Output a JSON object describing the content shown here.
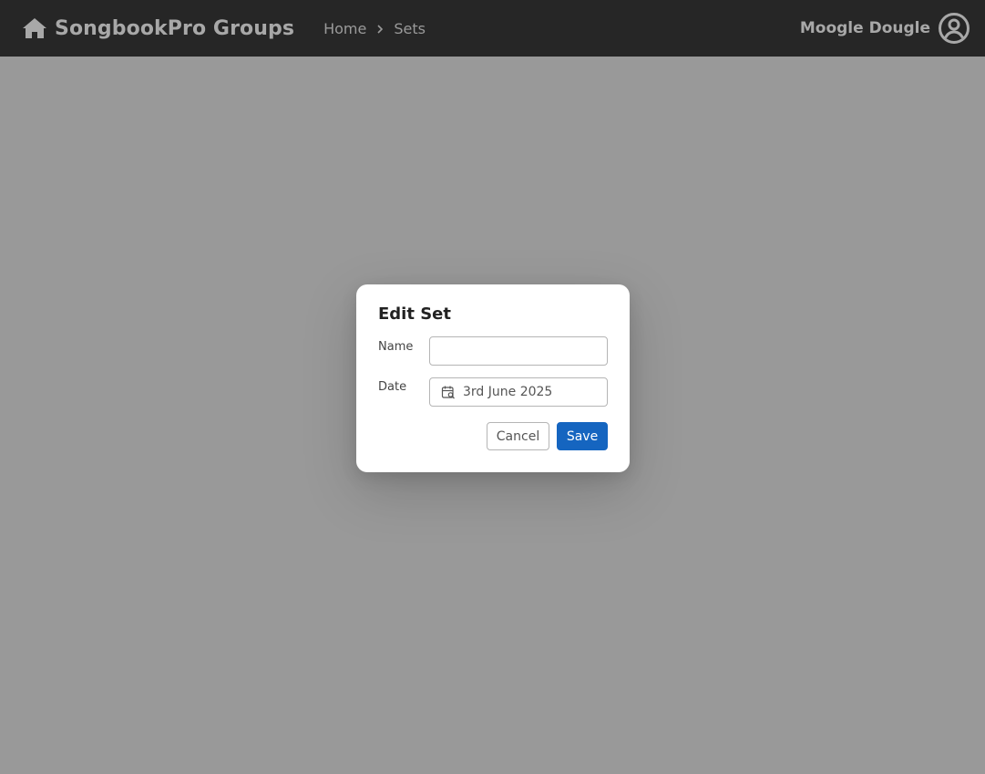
{
  "header": {
    "brand": "SongbookPro Groups",
    "breadcrumb": [
      "Home",
      "Sets"
    ],
    "user_name": "Moogle Dougle"
  },
  "dialog": {
    "title": "Edit Set",
    "name_label": "Name",
    "name_value": "",
    "name_placeholder": "",
    "date_label": "Date",
    "date_value": "3rd June 2025",
    "cancel_label": "Cancel",
    "save_label": "Save"
  },
  "icons": {
    "brand": "home-icon",
    "separator": "chevron-right-icon",
    "user": "account-circle-icon",
    "date": "calendar-search-icon"
  },
  "colors": {
    "topbar": "#262626",
    "overlay_background": "#999999",
    "primary": "#1565c0",
    "dialog_background": "#ffffff"
  }
}
